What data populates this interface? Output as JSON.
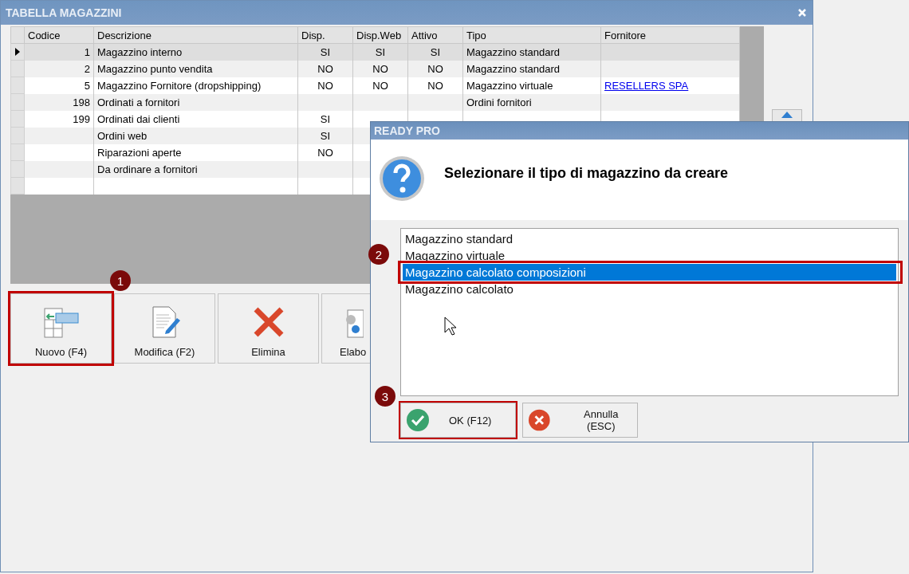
{
  "main_window": {
    "title": "TABELLA MAGAZZINI",
    "table": {
      "columns": [
        "Codice",
        "Descrizione",
        "Disp.",
        "Disp.Web",
        "Attivo",
        "Tipo",
        "Fornitore"
      ],
      "rows": [
        {
          "selected": true,
          "cells": [
            "1",
            "Magazzino interno",
            "SI",
            "SI",
            "SI",
            "Magazzino standard",
            null
          ]
        },
        {
          "selected": false,
          "cells": [
            "2",
            "Magazzino punto vendita",
            "NO",
            "NO",
            "NO",
            "Magazzino standard",
            null
          ]
        },
        {
          "selected": false,
          "cells": [
            "5",
            "Magazzino Fornitore (dropshipping)",
            "NO",
            "NO",
            "NO",
            "Magazzino virtuale",
            "RESELLERS SPA"
          ]
        },
        {
          "selected": false,
          "cells": [
            "198",
            "Ordinati a fornitori",
            null,
            null,
            null,
            "Ordini fornitori",
            null
          ]
        },
        {
          "selected": false,
          "cells": [
            "199",
            "Ordinati dai clienti",
            "SI",
            null,
            null,
            null,
            null
          ]
        },
        {
          "selected": false,
          "cells": [
            null,
            "Ordini web",
            "SI",
            null,
            null,
            null,
            null
          ]
        },
        {
          "selected": false,
          "cells": [
            null,
            "Riparazioni aperte",
            "NO",
            null,
            null,
            null,
            null
          ]
        },
        {
          "selected": false,
          "cells": [
            null,
            "Da ordinare a fornitori",
            null,
            null,
            null,
            null,
            null
          ]
        },
        {
          "selected": false,
          "cells": [
            null,
            null,
            null,
            null,
            null,
            null,
            null
          ]
        }
      ]
    },
    "buttons": [
      {
        "label": "Nuovo (F4)",
        "kind": "new",
        "highlighted": true,
        "badge": "1"
      },
      {
        "label": "Modifica (F2)",
        "kind": "edit",
        "highlighted": false
      },
      {
        "label": "Elimina",
        "kind": "delete",
        "highlighted": false
      },
      {
        "label": "Elabo",
        "kind": "process",
        "highlighted": false
      }
    ]
  },
  "dialog": {
    "title": "READY PRO",
    "message": "Selezionare il tipo di magazzino da creare",
    "options": [
      {
        "label": "Magazzino standard",
        "selected": false
      },
      {
        "label": "Magazzino virtuale",
        "selected": false
      },
      {
        "label": "Magazzino calcolato composizioni",
        "selected": true,
        "highlighted": true,
        "badge": "2"
      },
      {
        "label": "Magazzino calcolato",
        "selected": false
      }
    ],
    "buttons": [
      {
        "label": "OK (F12)",
        "kind": "ok",
        "highlighted": true,
        "badge": "3"
      },
      {
        "label": "Annulla (ESC)",
        "kind": "cancel",
        "highlighted": false
      }
    ]
  }
}
